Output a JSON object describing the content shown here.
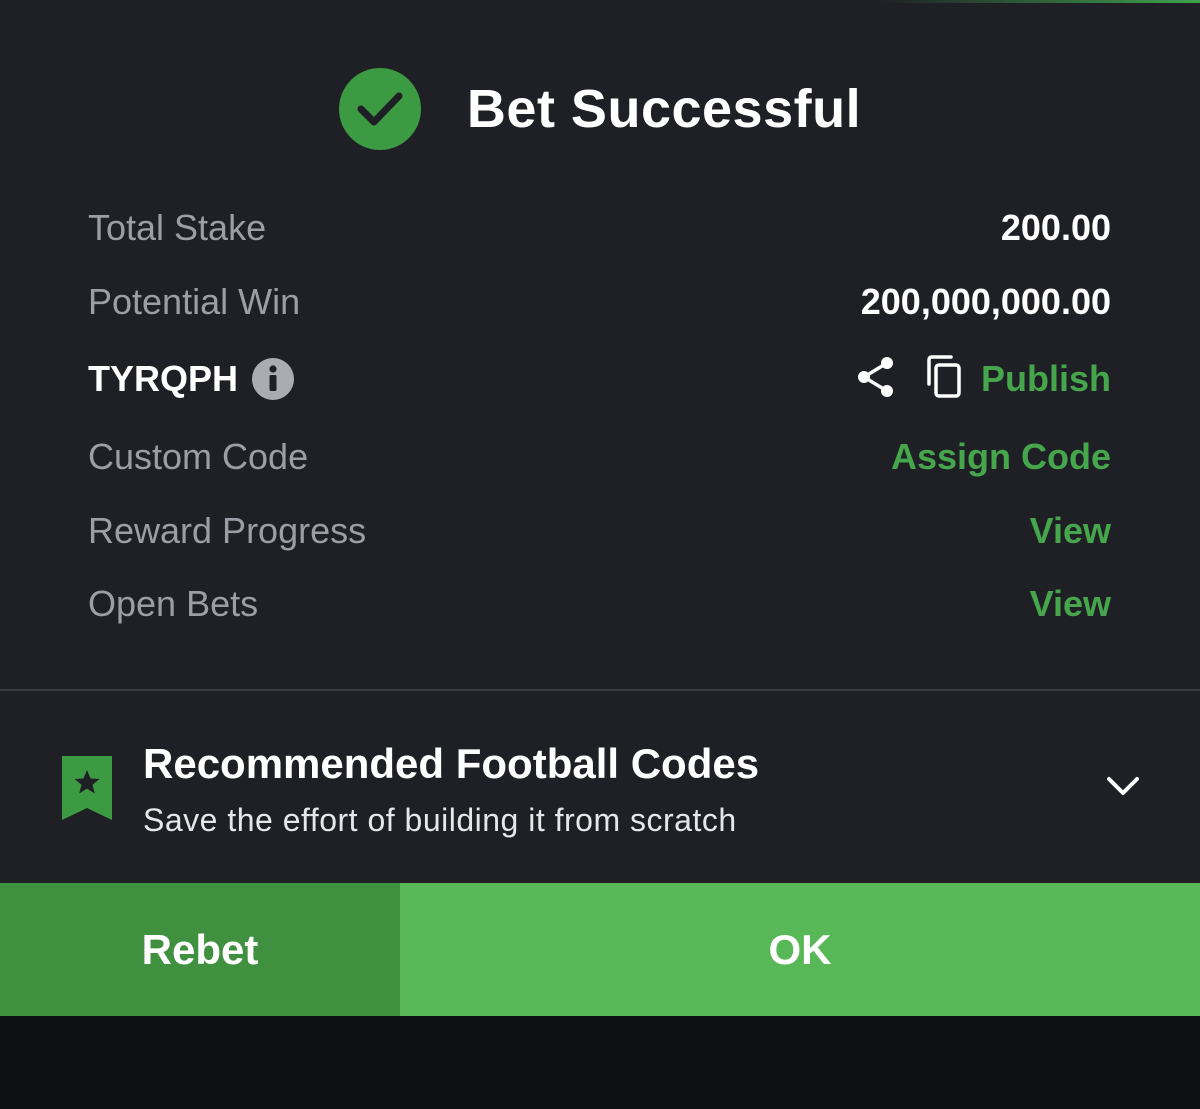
{
  "header": {
    "title": "Bet Successful"
  },
  "summary": {
    "total_stake_label": "Total Stake",
    "total_stake_value": "200.00",
    "potential_win_label": "Potential Win",
    "potential_win_value": "200,000,000.00",
    "booking_code": "TYRQPH",
    "publish_label": "Publish",
    "custom_code_label": "Custom Code",
    "assign_code_label": "Assign Code",
    "reward_progress_label": "Reward Progress",
    "reward_progress_link": "View",
    "open_bets_label": "Open Bets",
    "open_bets_link": "View"
  },
  "recommended": {
    "title": "Recommended Football Codes",
    "subtitle": "Save the effort of building it from scratch"
  },
  "buttons": {
    "rebet_label": "Rebet",
    "ok_label": "OK"
  },
  "colors": {
    "background": "#1f2025",
    "accent_green": "#46a64c",
    "ok_button": "#58b756",
    "rebet_button": "#3f913f"
  },
  "icons": {
    "success": "check-circle-icon",
    "info": "info-icon",
    "share": "share-icon",
    "copy": "copy-icon",
    "bookmark": "bookmark-star-icon",
    "expand": "chevron-down-icon"
  }
}
